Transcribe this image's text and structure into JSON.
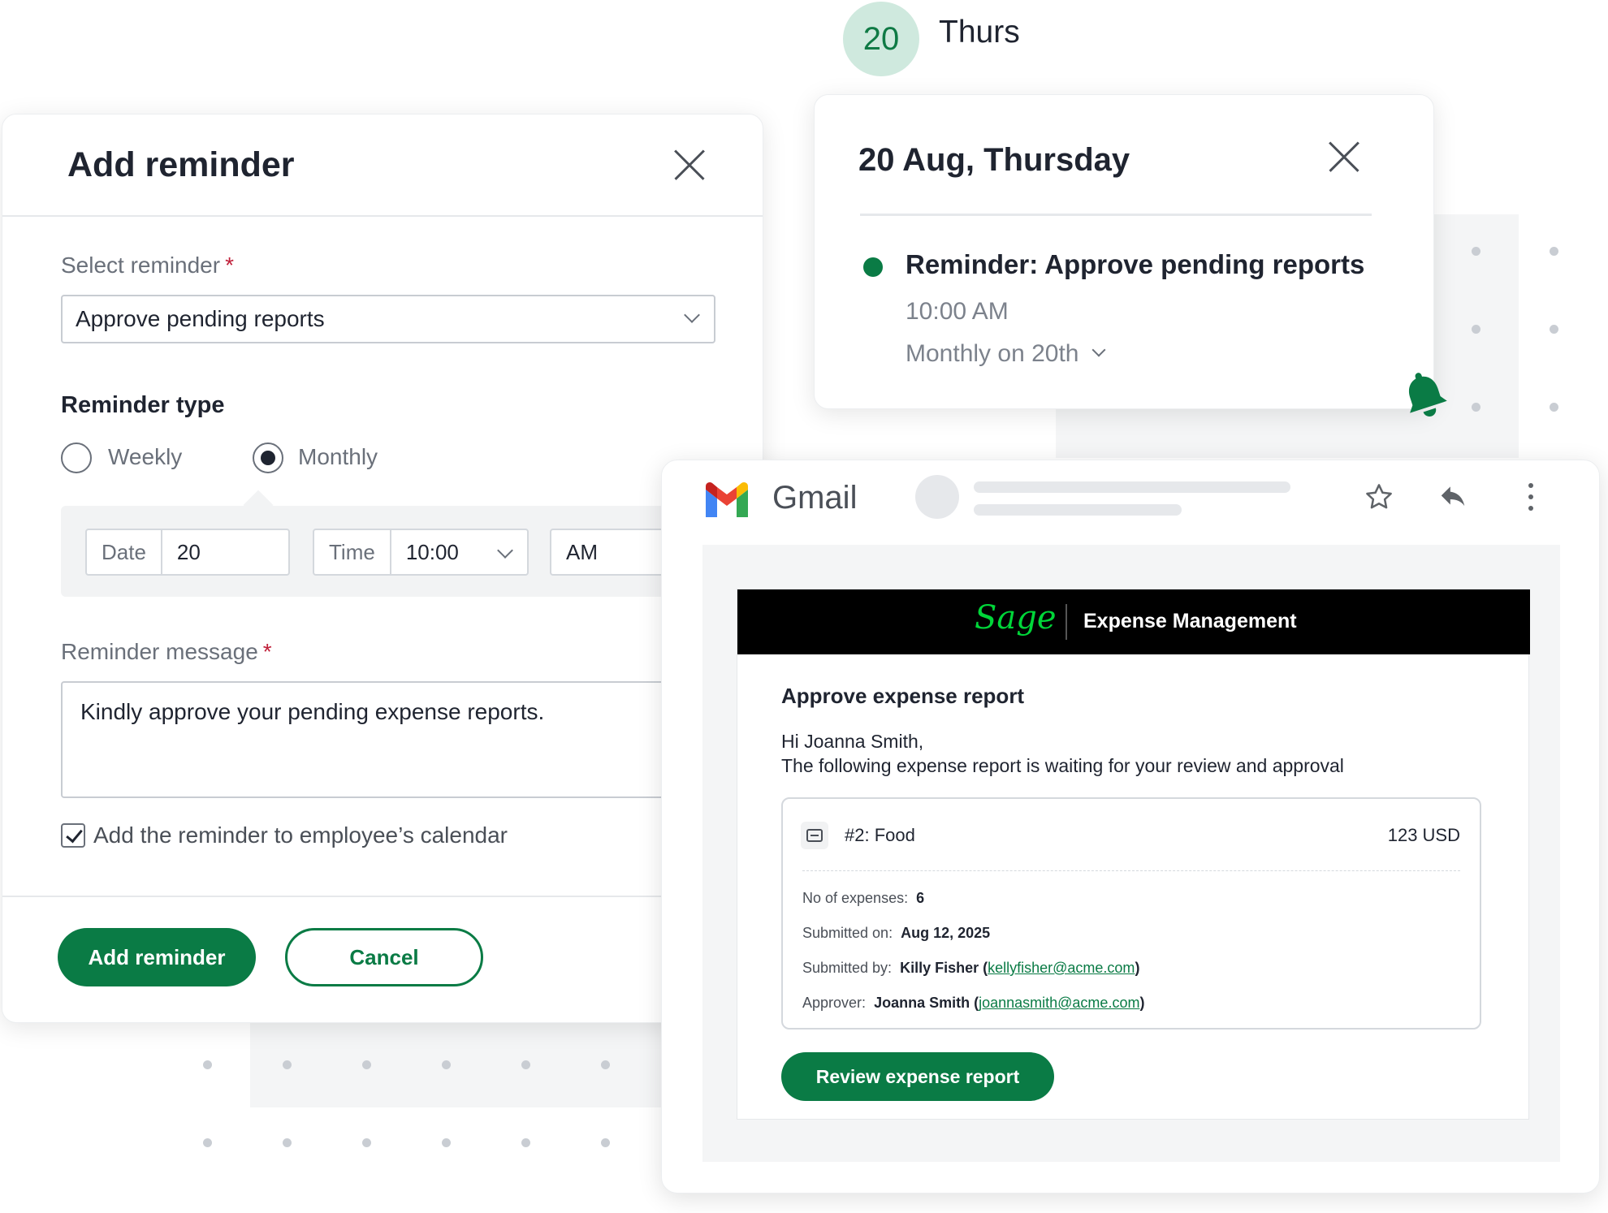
{
  "date_badge": {
    "number": "20",
    "day": "Thurs"
  },
  "reminder_modal": {
    "title": "Add reminder",
    "select_label": "Select reminder",
    "required_mark": "*",
    "select_value": "Approve pending reports",
    "type_heading": "Reminder type",
    "type_options": [
      "Weekly",
      "Monthly"
    ],
    "type_selected": "Monthly",
    "schedule": {
      "date_label": "Date",
      "date_value": "20",
      "time_label": "Time",
      "time_value": "10:00",
      "ampm_value": "AM"
    },
    "message_label": "Reminder message",
    "message_value": "Kindly approve your pending expense reports.",
    "calendar_checkbox_label": "Add the reminder to employee’s calendar",
    "calendar_checked": true,
    "primary_button": "Add reminder",
    "cancel_button": "Cancel"
  },
  "event_card": {
    "title": "20 Aug, Thursday",
    "event_name": "Reminder: Approve pending reports",
    "event_time": "10:00 AM",
    "event_recurrence": "Monthly on 20th"
  },
  "gmail": {
    "app_name": "Gmail",
    "email": {
      "brand": "Sage",
      "header_title": "Expense Management",
      "heading": "Approve expense report",
      "greeting": "Hi Joanna Smith,",
      "body": "The following expense report is waiting for your review and approval",
      "report": {
        "name": "#2: Food",
        "amount": "123 USD",
        "expenses_label": "No of expenses:",
        "expenses_value": "6",
        "submitted_on_label": "Submitted on:",
        "submitted_on_value": "Aug 12, 2025",
        "submitted_by_label": "Submitted by:",
        "submitted_by_name": "Killy Fisher",
        "submitted_by_email": "kellyfisher@acme.com",
        "approver_label": "Approver:",
        "approver_name": "Joanna Smith",
        "approver_email": "joannasmith@acme.com"
      },
      "cta_button": "Review expense report"
    }
  },
  "colors": {
    "brand_green": "#0a7b45",
    "badge_bg": "#cfe9de",
    "sage_green": "#00d639"
  },
  "icons": [
    "close-icon",
    "chevron-down-icon",
    "bell-icon",
    "gmail-logo-icon",
    "star-icon",
    "reply-icon",
    "more-vertical-icon",
    "folder-icon",
    "checkmark-icon"
  ]
}
